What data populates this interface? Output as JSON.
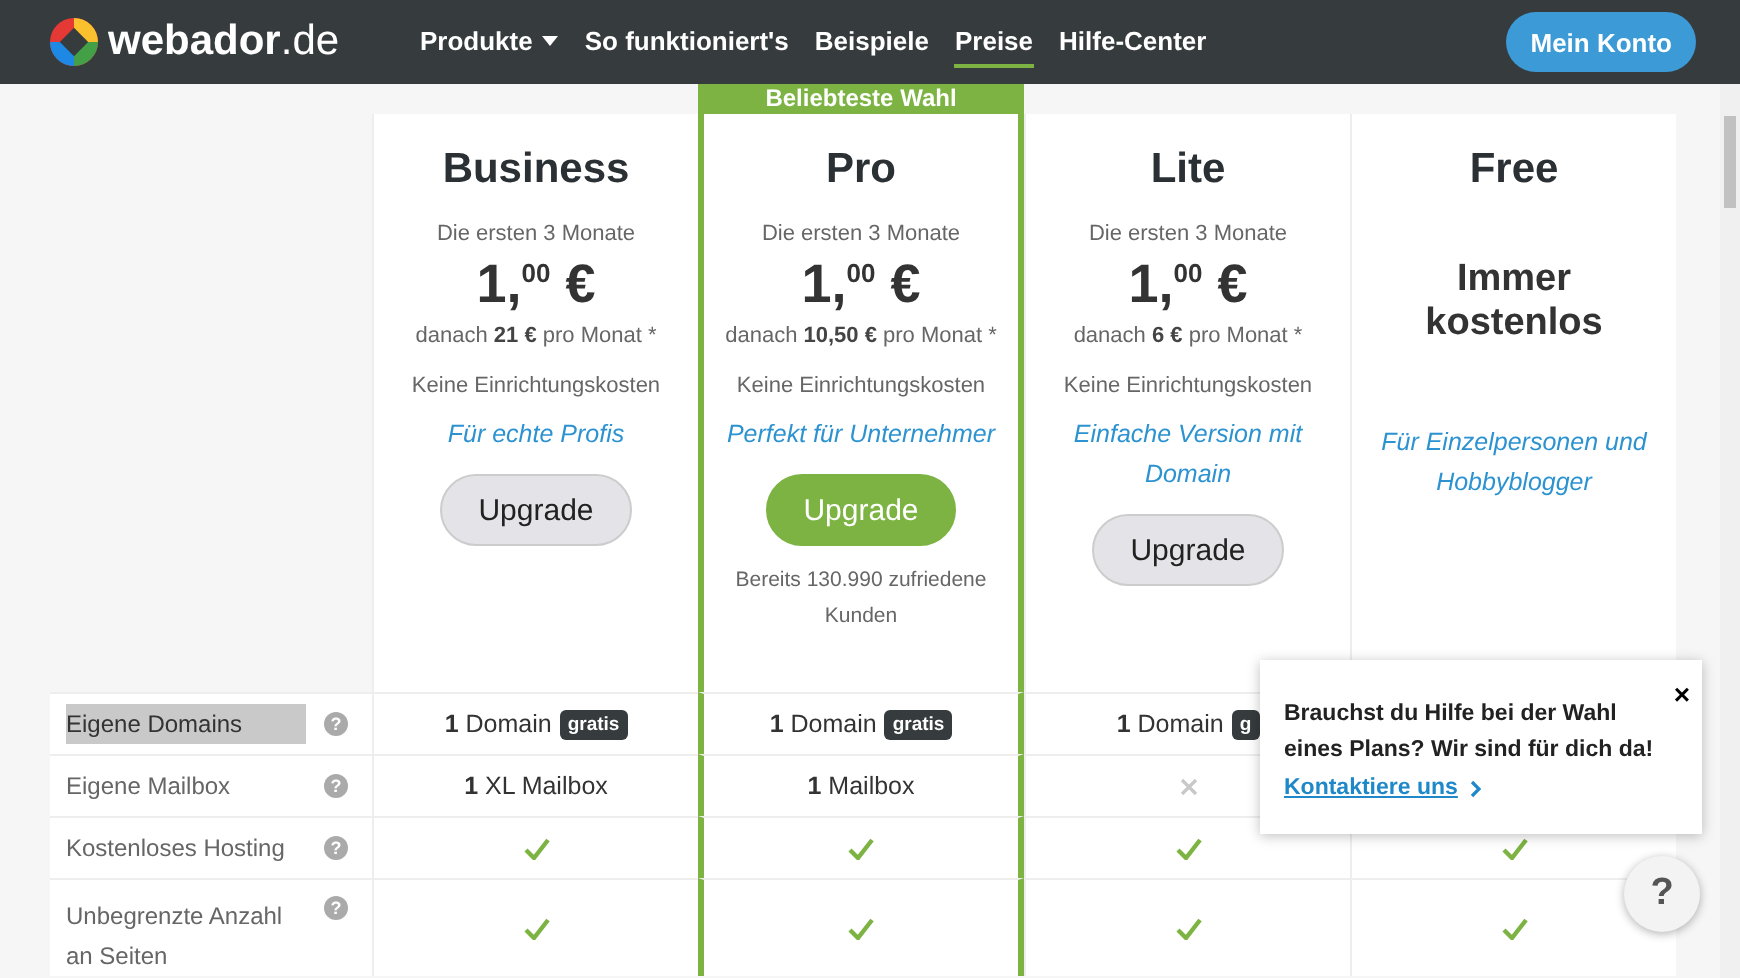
{
  "header": {
    "logo": "webador",
    "logo_suffix": ".de",
    "nav": [
      {
        "label": "Produkte",
        "dropdown": true,
        "selected": false
      },
      {
        "label": "So funktioniert's",
        "dropdown": false,
        "selected": false
      },
      {
        "label": "Beispiele",
        "dropdown": false,
        "selected": false
      },
      {
        "label": "Preise",
        "dropdown": false,
        "selected": true
      },
      {
        "label": "Hilfe-Center",
        "dropdown": false,
        "selected": false
      }
    ],
    "account_button": "Mein Konto"
  },
  "plans": [
    {
      "name": "Business",
      "featured": false,
      "intro": "Die ersten 3 Monate",
      "price": "1,$^{00}$ €",
      "after": "danach **21 €** pro Monat *",
      "setup": "Keine Einrichtungskosten",
      "tagline": "Für echte Profis",
      "button": "Upgrade"
    },
    {
      "name": "Pro",
      "featured": true,
      "banner": "Beliebteste Wahl",
      "intro": "Die ersten 3 Monate",
      "price": "1,$^{00}$ €",
      "after": "danach **10,50 €** pro Monat *",
      "setup": "Keine Einrichtungskosten",
      "tagline": "Perfekt für Unternehmer",
      "button": "Upgrade",
      "note": "Bereits 130.990 zufriedene Kunden"
    },
    {
      "name": "Lite",
      "featured": false,
      "intro": "Die ersten 3 Monate",
      "price": "1,$^{00}$ €",
      "after": "danach **6 €** pro Monat *",
      "setup": "Keine Einrichtungskosten",
      "tagline": "Einfache Version mit Domain",
      "button": "Upgrade"
    },
    {
      "name": "Free",
      "featured": false,
      "free_label": "Immer kostenlos",
      "tagline": "Für Einzelpersonen und Hobbyblogger"
    }
  ],
  "features": [
    {
      "label": "Eigene Domains",
      "highlighted": true,
      "help": "?",
      "cells": [
        {
          "kind": "text",
          "text": "**1** Domain",
          "badge": "gratis"
        },
        {
          "kind": "text",
          "text": "**1** Domain",
          "badge": "gratis"
        },
        {
          "kind": "text",
          "text": "**1** Domain",
          "badge": "g"
        },
        {
          "kind": "hidden"
        }
      ]
    },
    {
      "label": "Eigene Mailbox",
      "highlighted": false,
      "help": "?",
      "cells": [
        {
          "kind": "text",
          "text": "**1** XL Mailbox"
        },
        {
          "kind": "text",
          "text": "**1** Mailbox"
        },
        {
          "kind": "cross"
        },
        {
          "kind": "hidden"
        }
      ]
    },
    {
      "label": "Kostenloses Hosting",
      "highlighted": false,
      "help": "?",
      "cells": [
        {
          "kind": "check"
        },
        {
          "kind": "check"
        },
        {
          "kind": "check"
        },
        {
          "kind": "check"
        }
      ]
    },
    {
      "label": "Unbegrenzte Anzahl an Seiten",
      "highlighted": false,
      "help": "?",
      "cells": [
        {
          "kind": "check"
        },
        {
          "kind": "check"
        },
        {
          "kind": "check"
        },
        {
          "kind": "check"
        }
      ]
    }
  ],
  "help_popup": {
    "text": "Brauchst du Hilfe bei der Wahl eines Plans? Wir sind für dich da!",
    "link": "Kontaktiere uns",
    "close": "×"
  },
  "help_button": "?"
}
